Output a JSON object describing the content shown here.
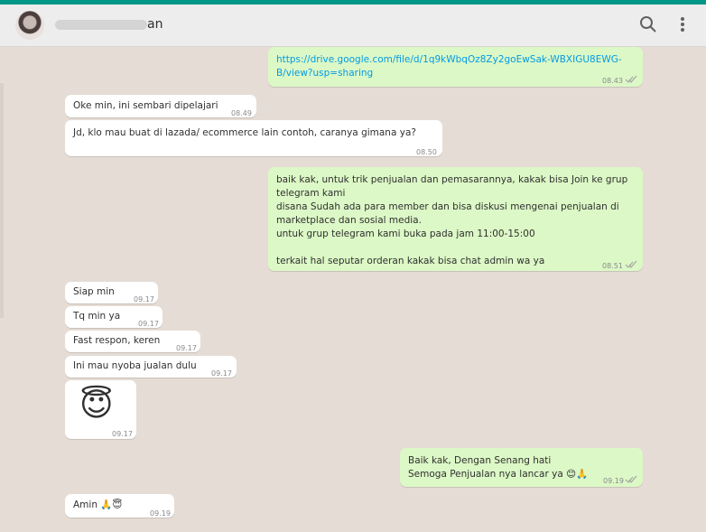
{
  "header": {
    "contact_name_visible_suffix": "an",
    "search_icon": "search-icon",
    "menu_icon": "vertical-dots-icon"
  },
  "messages": [
    {
      "dir": "out",
      "text": "https://drive.google.com/file/d/1q9kWbqOz8Zy2goEwSak-WBXIGU8EWG-\nB/view?usp=sharing",
      "time": "08.43",
      "link": true
    },
    {
      "dir": "in",
      "text": "Oke min, ini sembari dipelajari",
      "time": "08.49"
    },
    {
      "dir": "in",
      "text": "Jd, klo mau buat di lazada/ ecommerce lain contoh, caranya gimana ya?",
      "time": "08.50"
    },
    {
      "dir": "out",
      "text": "baik kak, untuk trik penjualan dan pemasarannya, kakak bisa Join ke grup\ntelegram kami\ndisana Sudah ada para member dan bisa diskusi mengenai penjualan di\nmarketplace dan sosial media.\nuntuk grup telegram kami buka pada jam 11:00-15:00\n\nterkait hal seputar orderan kakak bisa chat admin wa ya",
      "time": "08.51"
    },
    {
      "dir": "in",
      "text": "Siap min",
      "time": "09.17"
    },
    {
      "dir": "in",
      "text": "Tq min ya",
      "time": "09.17"
    },
    {
      "dir": "in",
      "text": "Fast respon, keren",
      "time": "09.17"
    },
    {
      "dir": "in",
      "text": "Ini mau nyoba jualan dulu",
      "time": "09.17"
    },
    {
      "dir": "in",
      "text": "😇",
      "time": "09.17"
    },
    {
      "dir": "out",
      "text": "Baik kak, Dengan Senang hati\nSemoga Penjualan nya lancar ya 😊🙏",
      "time": "09.19"
    },
    {
      "dir": "in",
      "text": "Amin 🙏😇",
      "time": "09.19"
    }
  ]
}
